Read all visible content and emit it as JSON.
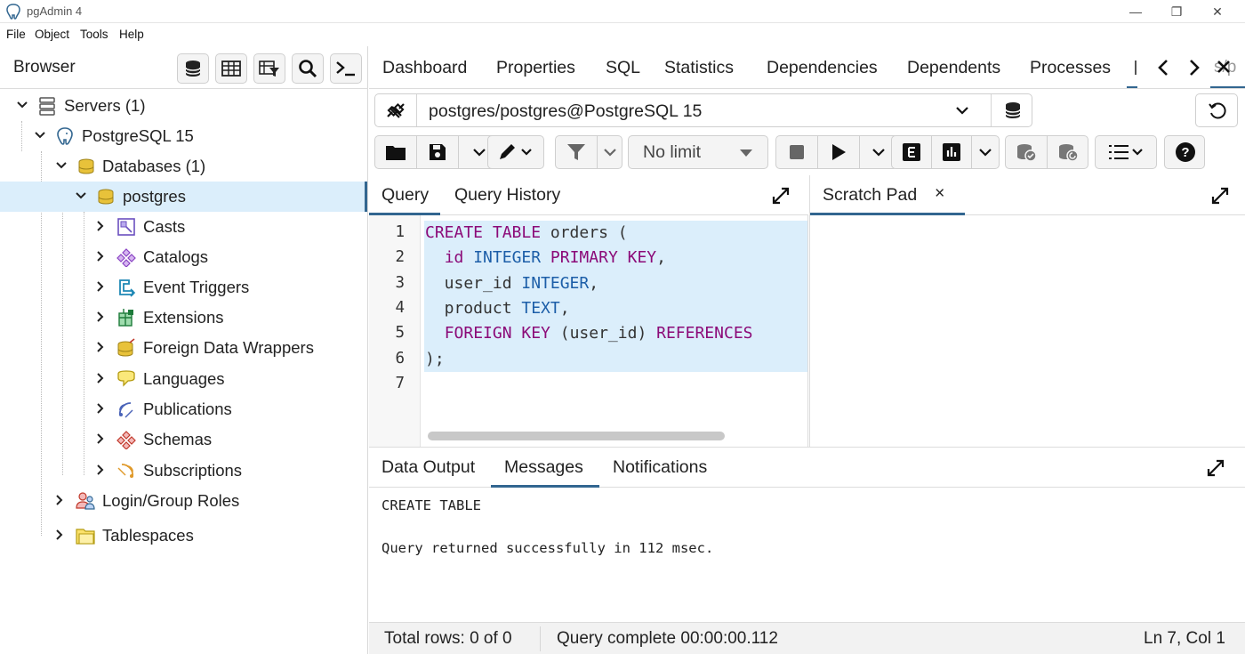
{
  "window": {
    "title": "pgAdmin 4",
    "controls": [
      "—",
      "❐",
      "✕"
    ]
  },
  "menu": [
    "File",
    "Object",
    "Tools",
    "Help"
  ],
  "browser": {
    "title": "Browser",
    "tree": [
      {
        "label": "Servers (1)",
        "icon": "servers-icon",
        "expanded": true,
        "level": 0
      },
      {
        "label": "PostgreSQL 15",
        "icon": "postgres-elephant-icon",
        "expanded": true,
        "level": 1
      },
      {
        "label": "Databases (1)",
        "icon": "databases-icon",
        "expanded": true,
        "level": 2
      },
      {
        "label": "postgres",
        "icon": "database-icon",
        "expanded": true,
        "level": 3,
        "selected": true
      },
      {
        "label": "Casts",
        "icon": "casts-icon",
        "expanded": false,
        "level": 4
      },
      {
        "label": "Catalogs",
        "icon": "catalogs-icon",
        "expanded": false,
        "level": 4
      },
      {
        "label": "Event Triggers",
        "icon": "event-triggers-icon",
        "expanded": false,
        "level": 4
      },
      {
        "label": "Extensions",
        "icon": "extensions-icon",
        "expanded": false,
        "level": 4
      },
      {
        "label": "Foreign Data Wrappers",
        "icon": "foreign-data-wrappers-icon",
        "expanded": false,
        "level": 4
      },
      {
        "label": "Languages",
        "icon": "languages-icon",
        "expanded": false,
        "level": 4
      },
      {
        "label": "Publications",
        "icon": "publications-icon",
        "expanded": false,
        "level": 4
      },
      {
        "label": "Schemas",
        "icon": "schemas-icon",
        "expanded": false,
        "level": 4
      },
      {
        "label": "Subscriptions",
        "icon": "subscriptions-icon",
        "expanded": false,
        "level": 4
      },
      {
        "label": "Login/Group Roles",
        "icon": "login-roles-icon",
        "expanded": false,
        "level": 2
      },
      {
        "label": "Tablespaces",
        "icon": "tablespaces-icon",
        "expanded": false,
        "level": 2
      }
    ]
  },
  "main_tabs": [
    "Dashboard",
    "Properties",
    "SQL",
    "Statistics",
    "Dependencies",
    "Dependents",
    "Processes"
  ],
  "main_tab_clipped": "s/p",
  "connection": {
    "value": "postgres/postgres@PostgreSQL 15"
  },
  "query_toolbar": {
    "limit": "No limit"
  },
  "editor_tabs": {
    "query": "Query",
    "history": "Query History",
    "scratch": "Scratch Pad",
    "scratch_close": "×"
  },
  "editor": {
    "line_numbers": [
      "1",
      "2",
      "3",
      "4",
      "5",
      "6",
      "7"
    ]
  },
  "output_tabs": [
    "Data Output",
    "Messages",
    "Notifications"
  ],
  "output": {
    "line1": "CREATE TABLE",
    "line2": "Query returned successfully in 112 msec."
  },
  "status": {
    "rows": "Total rows: 0 of 0",
    "complete": "Query complete 00:00:00.112",
    "cursor": "Ln 7, Col 1"
  },
  "colors": {
    "accent": "#326690",
    "selection": "#dbeefb",
    "keyword": "#8b0a78",
    "type": "#1c5ea8"
  }
}
